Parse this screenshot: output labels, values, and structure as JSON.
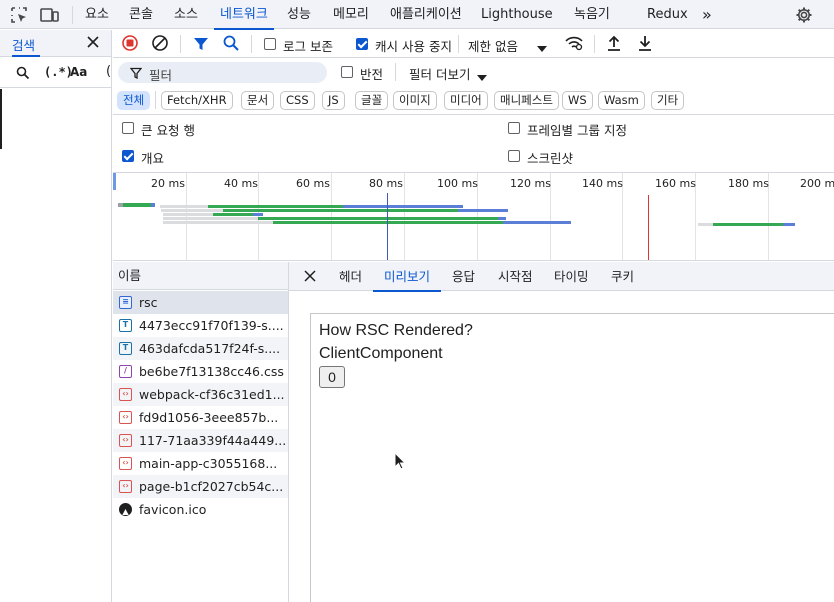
{
  "panel_tabs": [
    "요소",
    "콘솔",
    "소스",
    "네트워크",
    "성능",
    "메모리",
    "애플리케이션",
    "Lighthouse",
    "녹음기",
    "Redux"
  ],
  "more_tabs": "»",
  "search": {
    "title": "검색",
    "regex": "(.*)",
    "case": "Aa",
    "paren": "("
  },
  "toolbar": {
    "preserve_log": "로그 보존",
    "disable_cache": "캐시 사용 중지",
    "throttle": "제한 없음"
  },
  "filter": {
    "placeholder": "필터",
    "invert": "반전",
    "more_filters": "필터 더보기"
  },
  "type_chips": [
    "전체",
    "Fetch/XHR",
    "문서",
    "CSS",
    "JS",
    "글꼴",
    "이미지",
    "미디어",
    "매니페스트",
    "WS",
    "Wasm",
    "기타"
  ],
  "options": {
    "big_rows": "큰 요청 행",
    "group_by_frame": "프레임별 그룹 지정",
    "overview": "개요",
    "screenshots": "스크린샷"
  },
  "timeline": {
    "ticks": [
      "20 ms",
      "40 ms",
      "60 ms",
      "80 ms",
      "100 ms",
      "120 ms",
      "140 ms",
      "160 ms",
      "180 ms",
      "200 ms"
    ]
  },
  "requests": {
    "header": "이름",
    "items": [
      {
        "name": "rsc",
        "type": "doc"
      },
      {
        "name": "4473ecc91f70f139-s....",
        "type": "font"
      },
      {
        "name": "463dafcda517f24f-s....",
        "type": "font"
      },
      {
        "name": "be6be7f13138cc46.css",
        "type": "css"
      },
      {
        "name": "webpack-cf36c31ed1...",
        "type": "js"
      },
      {
        "name": "fd9d1056-3eee857b...",
        "type": "js"
      },
      {
        "name": "117-71aa339f44a449...",
        "type": "js"
      },
      {
        "name": "main-app-c3055168...",
        "type": "js"
      },
      {
        "name": "page-b1cf2027cb54c...",
        "type": "js"
      },
      {
        "name": "favicon.ico",
        "type": "icon"
      }
    ]
  },
  "detail_tabs": [
    "헤더",
    "미리보기",
    "응답",
    "시작점",
    "타이밍",
    "쿠키"
  ],
  "preview": {
    "line1": "How RSC Rendered?",
    "line2": "ClientComponent",
    "button": "0"
  },
  "colors": {
    "accent": "#0b57d0",
    "record": "#dc362e",
    "green": "#34a853",
    "blue": "#5b7fd6"
  }
}
